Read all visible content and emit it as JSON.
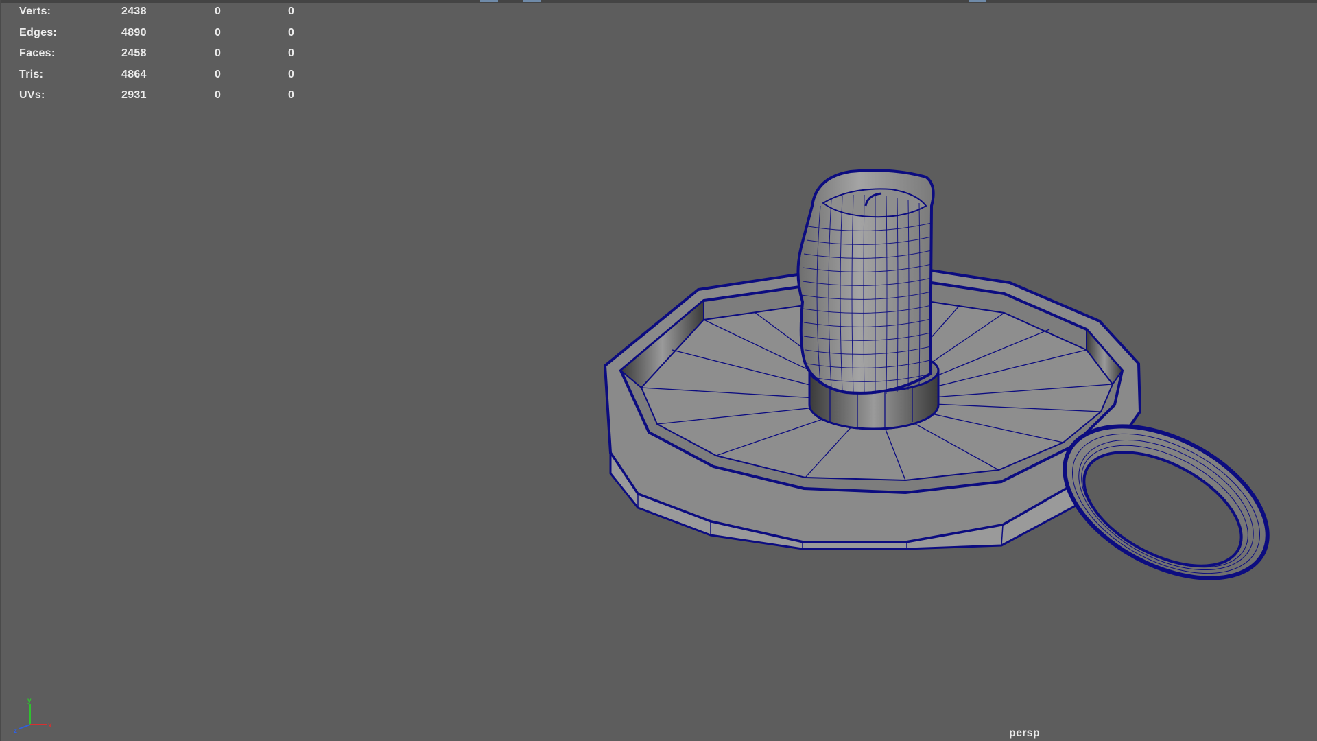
{
  "hud": {
    "rows": [
      {
        "label": "Verts:",
        "values": [
          "2438",
          "0",
          "0"
        ]
      },
      {
        "label": "Edges:",
        "values": [
          "4890",
          "0",
          "0"
        ]
      },
      {
        "label": "Faces:",
        "values": [
          "2458",
          "0",
          "0"
        ]
      },
      {
        "label": "Tris:",
        "values": [
          "4864",
          "0",
          "0"
        ]
      },
      {
        "label": "UVs:",
        "values": [
          "2931",
          "0",
          "0"
        ]
      }
    ]
  },
  "viewport": {
    "camera": "persp",
    "background_color": "#5d5d5d",
    "wireframe_color": "#0c0c80",
    "mesh_shade_color": "#8a8a8a"
  },
  "axis_gizmo": {
    "x_label": "x",
    "y_label": "y",
    "z_label": "z",
    "x_color": "#d83030",
    "y_color": "#30c030",
    "z_color": "#3060e0"
  }
}
